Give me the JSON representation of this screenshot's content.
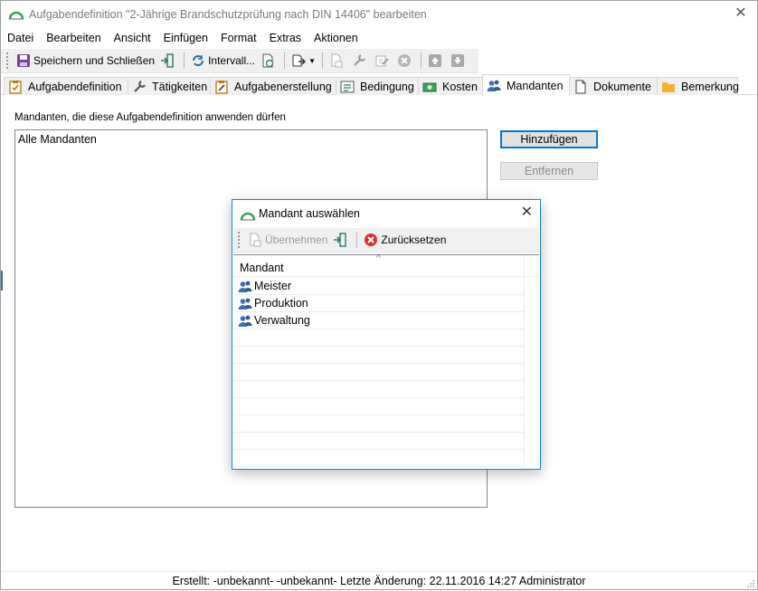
{
  "window": {
    "title": "Aufgabendefinition \"2-Jährige Brandschutzprüfung nach DIN 14406\" bearbeiten"
  },
  "menu": [
    {
      "label": "Datei"
    },
    {
      "label": "Bearbeiten"
    },
    {
      "label": "Ansicht"
    },
    {
      "label": "Einfügen"
    },
    {
      "label": "Format"
    },
    {
      "label": "Extras"
    },
    {
      "label": "Aktionen"
    }
  ],
  "toolbar": {
    "save_close_label": "Speichern und Schließen",
    "interval_label": "Intervall..."
  },
  "tabs": [
    {
      "label": "Aufgabendefinition"
    },
    {
      "label": "Tätigkeiten"
    },
    {
      "label": "Aufgabenerstellung"
    },
    {
      "label": "Bedingung"
    },
    {
      "label": "Kosten"
    },
    {
      "label": "Mandanten"
    },
    {
      "label": "Dokumente"
    },
    {
      "label": "Bemerkung"
    }
  ],
  "content": {
    "label": "Mandanten, die diese Aufgabendefinition anwenden dürfen",
    "list_items": [
      "Alle Mandanten"
    ],
    "add_button": "Hinzufügen",
    "remove_button": "Entfernen"
  },
  "status": "Erstellt: -unbekannt- -unbekannt-  Letzte Änderung: 22.11.2016 14:27 Administrator",
  "dialog": {
    "title": "Mandant auswählen",
    "apply_label": "Übernehmen",
    "reset_label": "Zurücksetzen",
    "column_header": "Mandant",
    "rows": [
      "Meister",
      "Produktion",
      "Verwaltung"
    ]
  },
  "colors": {
    "accent_blue": "#0078d7",
    "logo_green": "#3aa655",
    "reset_red": "#d9302f"
  }
}
